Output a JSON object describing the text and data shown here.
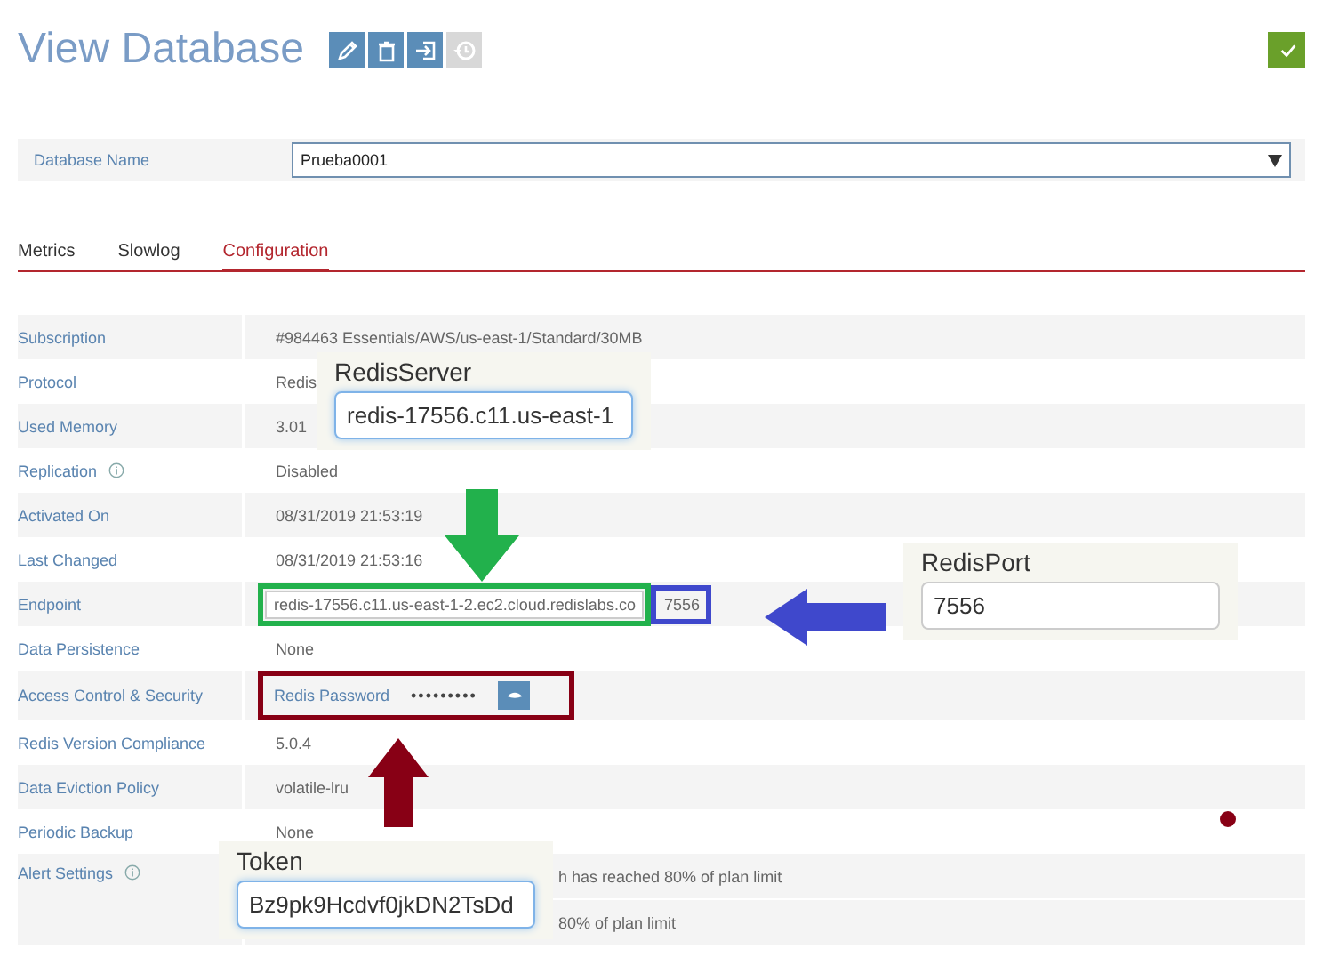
{
  "page": {
    "title": "View Database"
  },
  "header_actions": [
    {
      "kind": "edit",
      "disabled": false
    },
    {
      "kind": "delete",
      "disabled": false
    },
    {
      "kind": "export",
      "disabled": false
    },
    {
      "kind": "history",
      "disabled": true
    }
  ],
  "confirm": {
    "kind": "check"
  },
  "database_field": {
    "label": "Database Name",
    "value": "Prueba0001"
  },
  "tabs": [
    {
      "label": "Metrics",
      "selected": false
    },
    {
      "label": "Slowlog",
      "selected": false
    },
    {
      "label": "Configuration",
      "selected": true
    }
  ],
  "config_rows": [
    {
      "kind": "text",
      "label": "Subscription",
      "info": false,
      "value": "#984463 Essentials/AWS/us-east-1/Standard/30MB"
    },
    {
      "kind": "text",
      "label": "Protocol",
      "info": false,
      "value": "Redis"
    },
    {
      "kind": "text",
      "label": "Used Memory",
      "info": false,
      "value": "3.01"
    },
    {
      "kind": "text",
      "label": "Replication",
      "info": true,
      "value": "Disabled"
    },
    {
      "kind": "text",
      "label": "Activated On",
      "info": false,
      "value": "08/31/2019  21:53:19"
    },
    {
      "kind": "text",
      "label": "Last Changed",
      "info": false,
      "value": "08/31/2019  21:53:16"
    },
    {
      "kind": "endpoint",
      "label": "Endpoint",
      "info": false,
      "host": "redis-17556.c11.us-east-1-2.ec2.cloud.redislabs.co",
      "port": "7556"
    },
    {
      "kind": "text",
      "label": "Data Persistence",
      "info": false,
      "value": "None"
    },
    {
      "kind": "password",
      "label": "Access Control & Security",
      "info": false,
      "field_label": "Redis Password",
      "masked": "•••••••••"
    },
    {
      "kind": "text",
      "label": "Redis Version Compliance",
      "info": false,
      "value": "5.0.4"
    },
    {
      "kind": "text",
      "label": "Data Eviction Policy",
      "info": false,
      "value": "volatile-lru"
    },
    {
      "kind": "text",
      "label": "Periodic Backup",
      "info": false,
      "value": "None"
    },
    {
      "kind": "alerts",
      "label": "Alert Settings",
      "info": true,
      "values": [
        "h has reached 80% of plan limit",
        "80% of plan limit"
      ]
    }
  ],
  "callouts": [
    {
      "label": "RedisServer",
      "value": "redis-17556.c11.us-east-1",
      "focused": true
    },
    {
      "label": "RedisPort",
      "value": "7556",
      "focused": false
    },
    {
      "label": "Token",
      "value": "Bz9pk9Hcdvf0jkDN2TsDd",
      "focused": true
    }
  ],
  "annotations": [
    {
      "kind": "down-arrow",
      "color": "#22b14c"
    },
    {
      "kind": "left-arrow",
      "color": "#3f48cc"
    },
    {
      "kind": "up-arrow",
      "color": "#880015"
    },
    {
      "kind": "dot",
      "color": "#880015"
    }
  ]
}
